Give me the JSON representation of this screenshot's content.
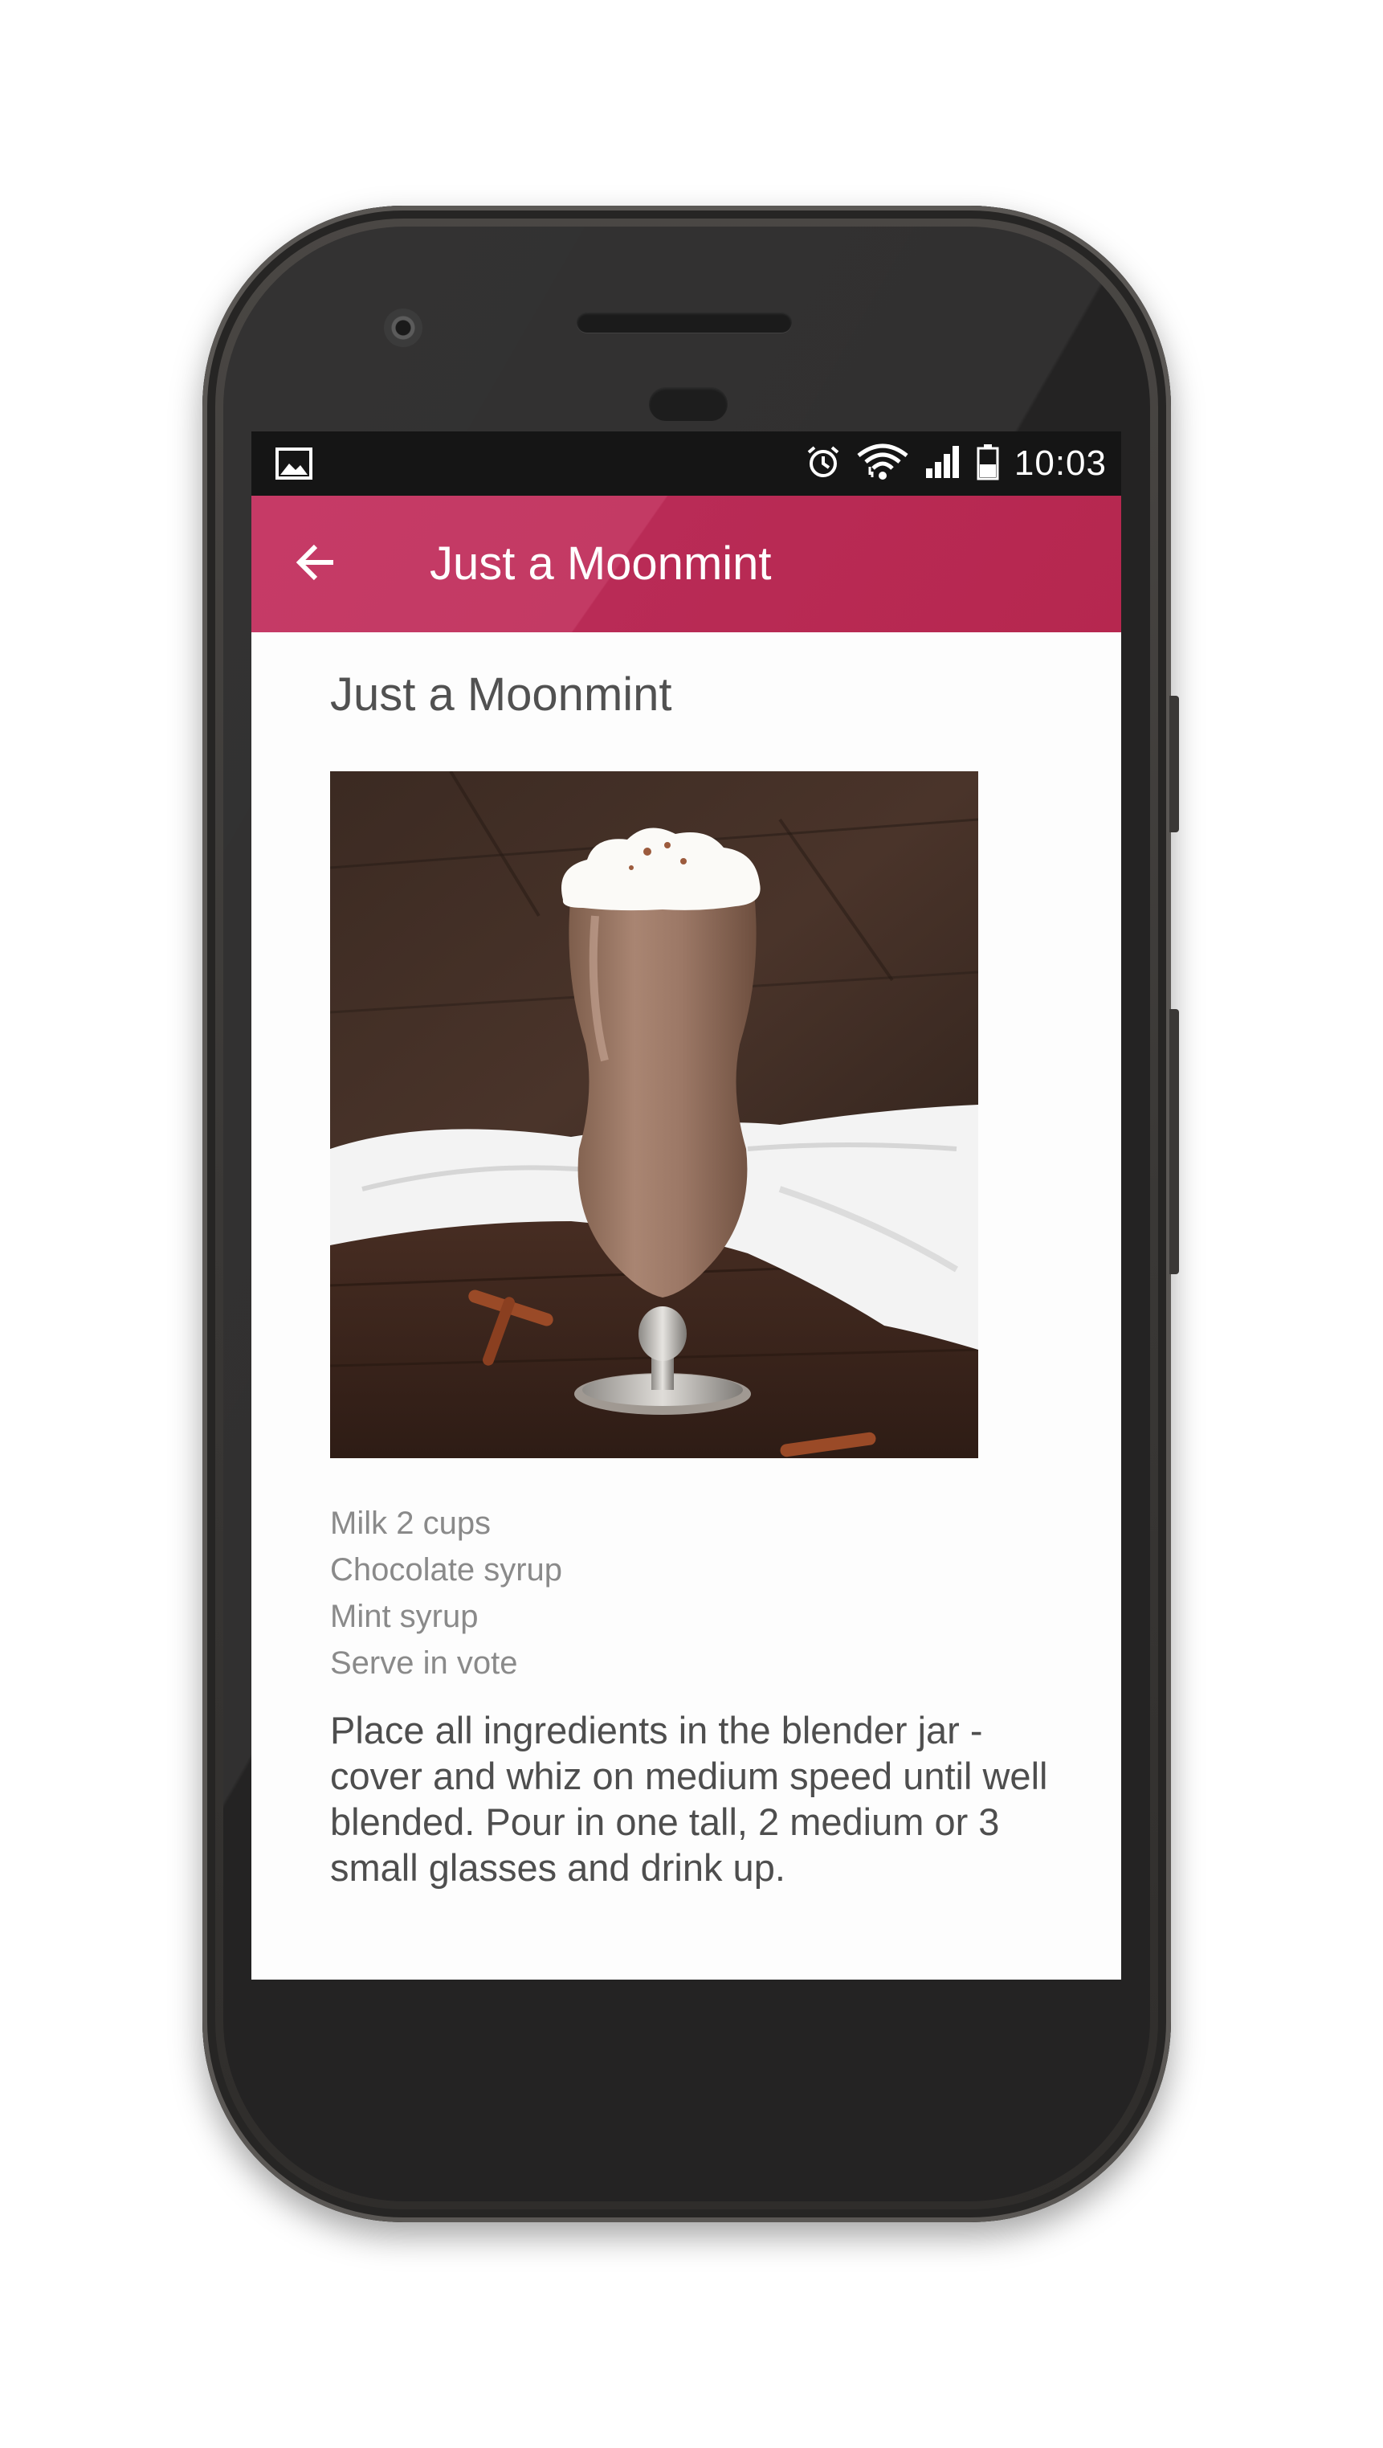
{
  "status_bar": {
    "time": "10:03",
    "icons": [
      "image-notification-icon",
      "alarm-icon",
      "wifi-icon",
      "signal-icon",
      "battery-icon"
    ]
  },
  "app_bar": {
    "title": "Just a Moonmint",
    "back_icon": "arrow-left-icon",
    "color": "#c62a58"
  },
  "recipe": {
    "title": "Just a Moonmint",
    "image_subject": "milkshake-glass-photo",
    "ingredients": [
      "Milk 2 cups",
      "Chocolate syrup",
      "Mint syrup",
      "Serve in vote"
    ],
    "instructions": "Place all ingredients in the blender jar - cover and whiz on medium speed until well blended. Pour in one tall, 2 medium or 3 small glasses and drink up."
  }
}
